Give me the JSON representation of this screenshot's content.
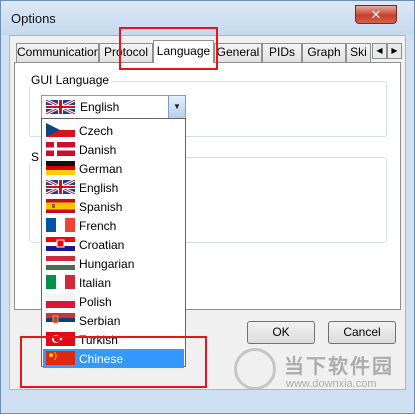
{
  "window": {
    "title": "Options",
    "close_glyph": "✕"
  },
  "tabs": [
    {
      "label": "Communication",
      "active": false
    },
    {
      "label": "Protocol",
      "active": false
    },
    {
      "label": "Language",
      "active": true
    },
    {
      "label": "General",
      "active": false
    },
    {
      "label": "PIDs",
      "active": false
    },
    {
      "label": "Graph",
      "active": false
    },
    {
      "label": "Ski",
      "active": false
    }
  ],
  "tab_scroll": {
    "left_glyph": "◀",
    "right_glyph": "▶"
  },
  "gui_language": {
    "group_label": "GUI Language",
    "selected": "English",
    "arrow_glyph": "▼"
  },
  "second_group": {
    "label_fragment": "S"
  },
  "dropdown": {
    "options": [
      "Czech",
      "Danish",
      "German",
      "English",
      "Spanish",
      "French",
      "Croatian",
      "Hungarian",
      "Italian",
      "Polish",
      "Serbian",
      "Turkish",
      "Chinese"
    ],
    "highlighted": "Chinese"
  },
  "buttons": {
    "ok": "OK",
    "cancel": "Cancel"
  },
  "colors": {
    "highlight": "#3399ff",
    "annotation": "#e8141b",
    "window_frame": "#cfe0f2"
  },
  "watermark": {
    "cn": "当下软件园",
    "url": "www.downxia.com"
  }
}
